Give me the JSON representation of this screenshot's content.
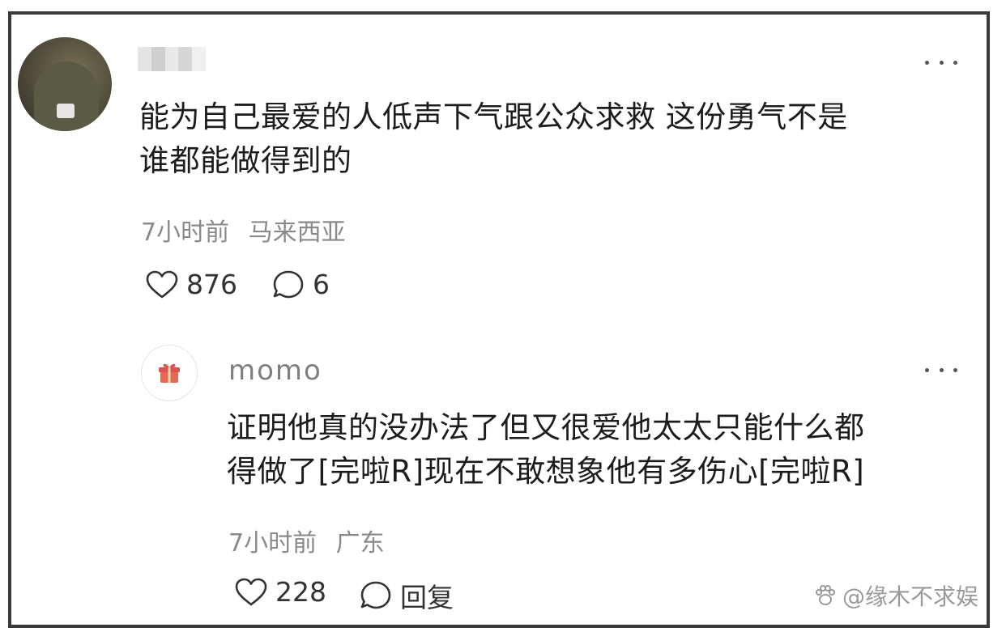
{
  "main_comment": {
    "text_line1": "能为自己最爱的人低声下气跟公众求救 这份勇气不是",
    "text_line2": "谁都能做得到的",
    "time": "7小时前",
    "location": "马来西亚",
    "like_count": "876",
    "reply_count": "6",
    "icons": {
      "more": "more-dots-icon",
      "like": "heart-icon",
      "reply": "comment-bubble-icon"
    }
  },
  "reply_comment": {
    "username": "momo",
    "text_line1": "证明他真的没办法了但又很爱他太太只能什么都",
    "text_line2": "得做了[完啦R]现在不敢想象他有多伤心[完啦R]",
    "time": "7小时前",
    "location": "广东",
    "like_count": "228",
    "reply_label": "回复",
    "icons": {
      "avatar": "gift-icon",
      "more": "more-dots-icon",
      "like": "heart-icon",
      "reply": "comment-bubble-icon"
    }
  },
  "watermark": {
    "text": "@缘木不求娱",
    "icon": "paw-icon"
  },
  "colors": {
    "frame_border": "#3a3a3a",
    "meta_text": "#8a8a8a",
    "gift_red": "#d9534f"
  }
}
